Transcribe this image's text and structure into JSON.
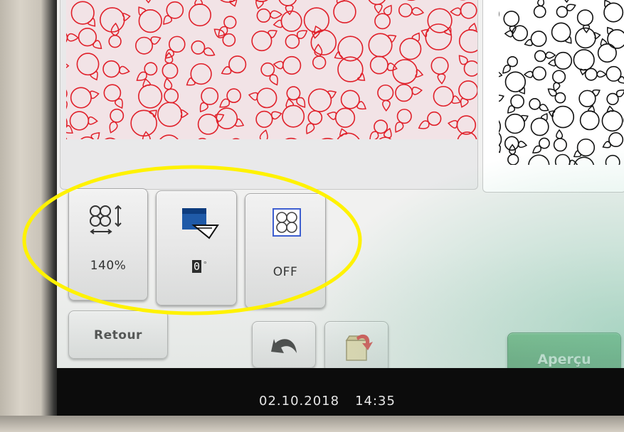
{
  "toolbar": {
    "size": {
      "value": "140%",
      "icon": "resize-icon"
    },
    "rotate": {
      "value": "0",
      "unit": "°",
      "icon": "rotate-icon"
    },
    "frame": {
      "value": "OFF",
      "icon": "quilt-frame-icon"
    },
    "back_label": "Retour",
    "undo_icon": "undo-arrow-icon",
    "memory_icon": "save-memory-icon",
    "preview_label": "Aperçu"
  },
  "status": {
    "date": "02.10.2018",
    "time": "14:35"
  },
  "colors": {
    "accent_green": "#3a8a4c",
    "pattern_red": "#e0202a",
    "highlight_yellow": "#fff200",
    "frame_blue": "#3e5fd0"
  }
}
